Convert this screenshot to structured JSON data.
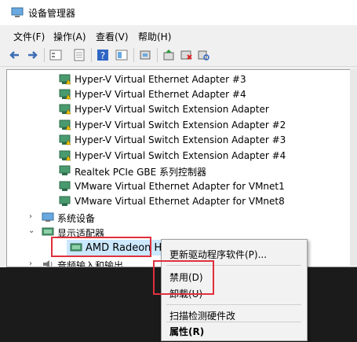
{
  "window": {
    "title": "设备管理器"
  },
  "menu": [
    "文件(F)",
    "操作(A)",
    "查看(V)",
    "帮助(H)"
  ],
  "toolbar_icons": [
    "back-icon",
    "forward-icon",
    "properties-icon",
    "help-icon",
    "driver-icon",
    "scan-icon",
    "enable-icon",
    "disable-icon",
    "uninstall-icon"
  ],
  "tree": {
    "network_items": [
      "Hyper-V Virtual Ethernet Adapter #3",
      "Hyper-V Virtual Ethernet Adapter #4",
      "Hyper-V Virtual Switch Extension Adapter",
      "Hyper-V Virtual Switch Extension Adapter #2",
      "Hyper-V Virtual Switch Extension Adapter #3",
      "Hyper-V Virtual Switch Extension Adapter #4",
      "Realtek PCIe GBE 系列控制器",
      "VMware Virtual Ethernet Adapter for VMnet1",
      "VMware Virtual Ethernet Adapter for VMnet8"
    ],
    "system_devices": "系统设备",
    "display_adapters": "显示适配器",
    "selected_device": "AMD Radeon HI",
    "audio": "音频输入和输出"
  },
  "context_menu": {
    "update": "更新驱动程序软件(P)...",
    "disable": "禁用(D)",
    "uninstall": "卸载(U)",
    "scan": "扫描检测硬件改",
    "properties": "属性(R)"
  },
  "colors": {
    "highlight": "#e0303d",
    "selection": "#cce8ff",
    "warning": "#f2c200"
  }
}
